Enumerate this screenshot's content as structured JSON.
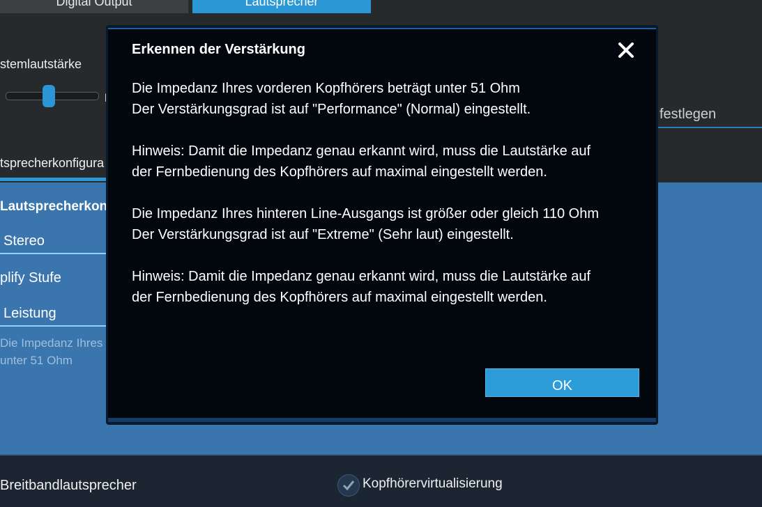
{
  "tabs": [
    {
      "label": "Digital Output",
      "active": false
    },
    {
      "label": "Lautsprecher",
      "active": true
    }
  ],
  "system_volume": {
    "label": "stemlautstärke",
    "marker": "l"
  },
  "festlegen_label": "festlegen",
  "config_tab_label": "tsprecherkonfigura",
  "panel": {
    "title": "Lautsprecherkon",
    "speaker_value": "Stereo",
    "amp_label": "plify Stufe",
    "amp_value": "Leistung",
    "hint_line1": "Die Impedanz Ihres",
    "hint_line2": "unter 51 Ohm"
  },
  "bottom": {
    "broadband_label": "Breitbandlautsprecher",
    "virtualization_label": "Kopfhörervirtualisierung",
    "virtualization_icon": "check-icon"
  },
  "dialog": {
    "title": "Erkennen der Verstärkung",
    "close_icon": "close-icon",
    "paragraphs": [
      [
        "Die Impedanz Ihres vorderen Kopfhörers beträgt unter 51 Ohm",
        "Der Verstärkungsgrad ist auf \"Performance\" (Normal) eingestellt."
      ],
      [
        "Hinweis: Damit die Impedanz genau erkannt wird, muss die Lautstärke auf",
        "der Fernbedienung des Kopfhörers auf maximal eingestellt werden."
      ],
      [
        "Die Impedanz Ihres hinteren Line-Ausgangs ist größer oder gleich 110 Ohm",
        "Der Verstärkungsgrad ist auf \"Extreme\" (Sehr laut) eingestellt."
      ],
      [
        "Hinweis: Damit die Impedanz genau erkannt wird, muss die Lautstärke auf",
        "der Fernbedienung des Kopfhörers auf maximal eingestellt werden."
      ]
    ],
    "ok_label": "OK"
  },
  "colors": {
    "accent": "#2b97d4",
    "panel_blue": "#3a75ae",
    "dialog_bg": "#02070e"
  }
}
